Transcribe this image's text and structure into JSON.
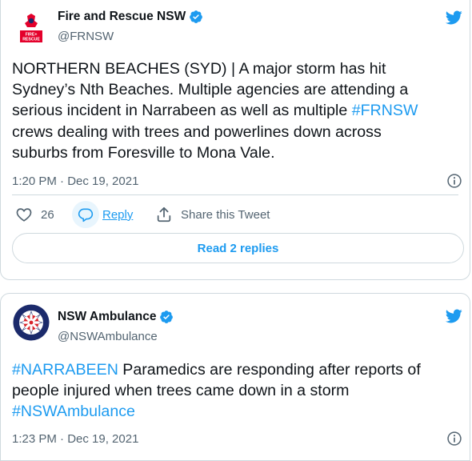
{
  "tweets": [
    {
      "author_name": "Fire and Rescue NSW",
      "handle": "@FRNSW",
      "avatar_text": "FIRE+RESCUE",
      "text_lines": [
        {
          "pre": "NORTHERN BEACHES (SYD) | A major storm has hit",
          "tag": "",
          "post": ""
        },
        {
          "pre": "Sydney’s Nth Beaches. Multiple agencies are attending a",
          "tag": "",
          "post": ""
        },
        {
          "pre": "serious incident in Narrabeen as well as multiple ",
          "tag": "#FRNSW",
          "post": ""
        },
        {
          "pre": "crews dealing with trees and powerlines down across",
          "tag": "",
          "post": ""
        },
        {
          "pre": "suburbs from Foresville to Mona Vale.",
          "tag": "",
          "post": ""
        }
      ],
      "timestamp": "1:20 PM · Dec 19, 2021",
      "likes_count": "26",
      "reply_label": "Reply",
      "share_label": "Share this Tweet",
      "read_replies_label": "Read 2 replies"
    },
    {
      "author_name": "NSW Ambulance",
      "handle": "@NSWAmbulance",
      "avatar_text": "NEW SOUTH WALES AMBULANCE",
      "text_lines": [
        {
          "pre": "",
          "tag": "#NARRABEEN",
          "post": " Paramedics are responding after reports of"
        },
        {
          "pre": "people injured when trees came down in a storm",
          "tag": "",
          "post": ""
        },
        {
          "pre": "",
          "tag": "#NSWAmbulance",
          "post": ""
        }
      ],
      "timestamp": "1:23 PM · Dec 19, 2021"
    }
  ],
  "colors": {
    "link_blue": "#1d9bf0",
    "text_primary": "#0f1419",
    "text_secondary": "#536471",
    "border": "#cfd9de",
    "frnsw_red": "#e4002b",
    "ambulance_red": "#d8232a"
  },
  "icons": {
    "verified": "verified-badge-icon",
    "bird": "twitter-bird-icon",
    "info": "info-icon",
    "heart": "heart-icon",
    "reply": "reply-bubble-icon",
    "share": "share-icon"
  }
}
